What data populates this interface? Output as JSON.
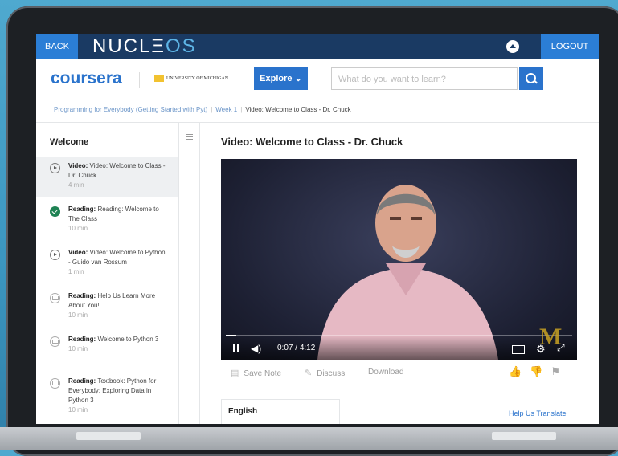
{
  "nucleos": {
    "back_label": "BACK",
    "logo_main": "NUCL",
    "logo_accent": "OS",
    "logo_mid": "Ξ",
    "logout_label": "LOGOUT"
  },
  "header": {
    "logo": "coursera",
    "partner": "UNIVERSITY OF MICHIGAN",
    "explore_label": "Explore",
    "explore_chevron": "⌄",
    "search_placeholder": "What do you want to learn?"
  },
  "breadcrumb": {
    "course": "Programming for Everybody (Getting Started with Pyt)",
    "week": "Week 1",
    "current": "Video: Welcome to Class - Dr. Chuck"
  },
  "sidebar": {
    "section_title": "Welcome",
    "items": [
      {
        "type": "Video:",
        "title": "Video: Welcome to Class - Dr. Chuck",
        "duration": "4 min",
        "icon": "play-icon",
        "state": "active"
      },
      {
        "type": "Reading:",
        "title": "Reading: Welcome to The Class",
        "duration": "10 min",
        "icon": "check-icon",
        "state": "done"
      },
      {
        "type": "Video:",
        "title": "Video: Welcome to Python - Guido van Rossum",
        "duration": "1 min",
        "icon": "play-icon",
        "state": ""
      },
      {
        "type": "Reading:",
        "title": "Help Us Learn More About You!",
        "duration": "10 min",
        "icon": "reading-icon",
        "state": ""
      },
      {
        "type": "Reading:",
        "title": "Welcome to Python 3",
        "duration": "10 min",
        "icon": "reading-icon",
        "state": ""
      },
      {
        "type": "Reading:",
        "title": "Textbook: Python for Everybody: Exploring Data in Python 3",
        "duration": "10 min",
        "icon": "reading-icon",
        "state": ""
      }
    ]
  },
  "main": {
    "title": "Video: Welcome to Class - Dr. Chuck",
    "player": {
      "current_time": "0:07",
      "separator": "/",
      "duration": "4:12",
      "progress": 0.03,
      "volume_symbol": "◀)",
      "gear_symbol": "⚙",
      "fullscreen_symbol": "⤢",
      "watermark": "M"
    },
    "actions": {
      "save_note": "Save Note",
      "discuss": "Discuss",
      "download": "Download"
    },
    "votes": {
      "like": "👍",
      "dislike": "👎",
      "flag": "⚑"
    },
    "transcript_language": "English",
    "translate_link": "Help Us Translate"
  },
  "colors": {
    "accent": "#2a73cc",
    "nucleos_bar": "#1a3a63",
    "complete": "#1f8354"
  }
}
